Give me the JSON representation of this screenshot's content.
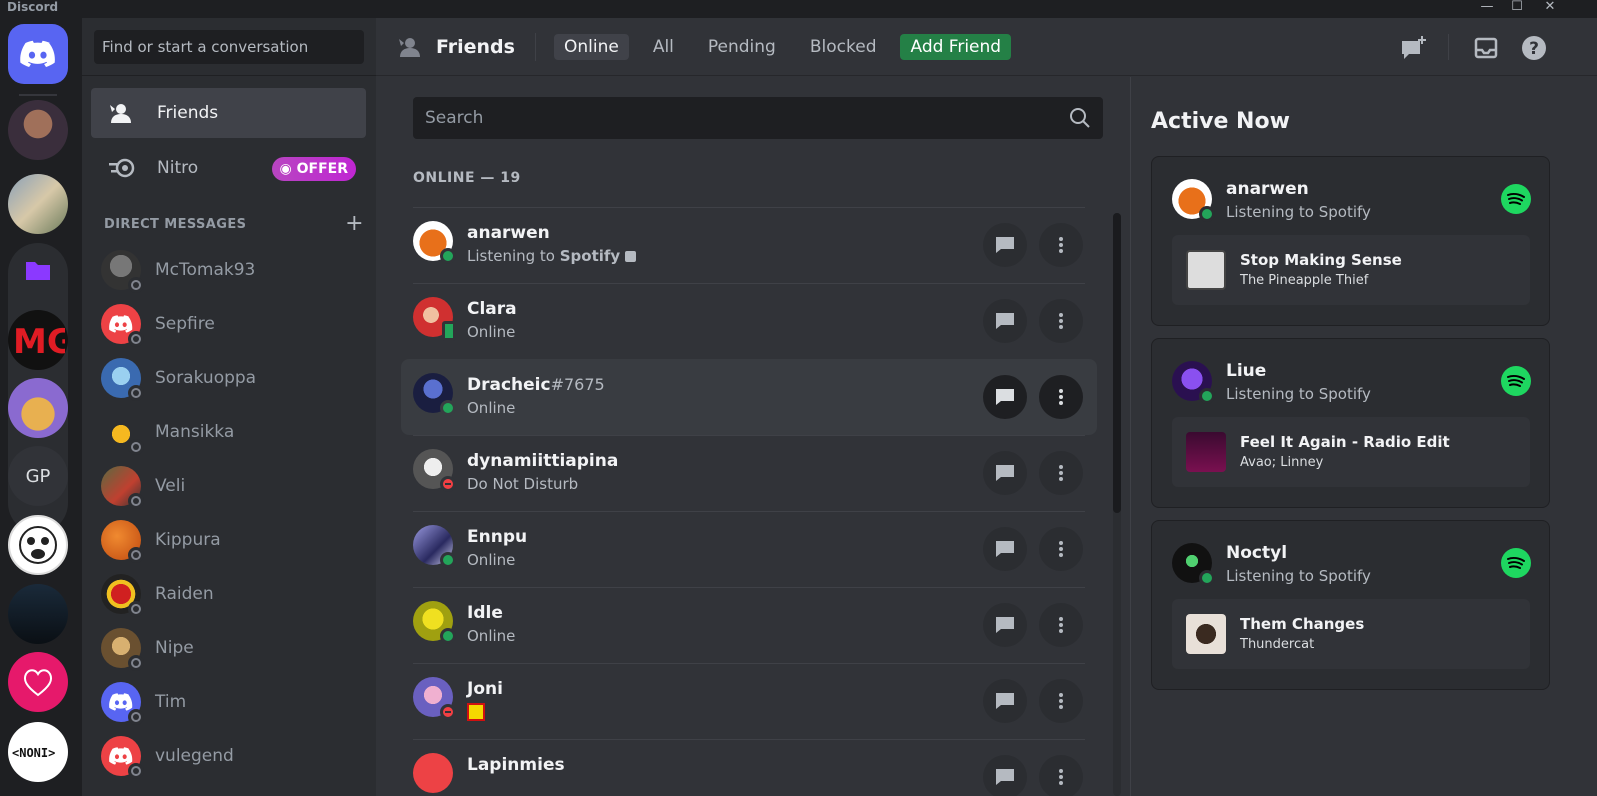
{
  "window": {
    "app_name": "Discord",
    "minimize": "—",
    "maximize": "☐",
    "close": "✕"
  },
  "servers": {
    "guild_initials": "GP"
  },
  "dm_sidebar": {
    "search_placeholder": "Find or start a conversation",
    "nav": {
      "friends": "Friends",
      "nitro": "Nitro",
      "offer": "OFFER"
    },
    "direct_messages_header": "DIRECT MESSAGES",
    "add_dm": "+",
    "dms": [
      "McTomak93",
      "Sepfire",
      "Sorakuoppa",
      "Mansikka",
      "Veli",
      "Kippura",
      "Raiden",
      "Nipe",
      "Tim",
      "vulegend"
    ]
  },
  "header": {
    "title": "Friends",
    "tabs": {
      "online": "Online",
      "all": "All",
      "pending": "Pending",
      "blocked": "Blocked",
      "add_friend": "Add Friend"
    }
  },
  "friends": {
    "search_placeholder": "Search",
    "online_header": "ONLINE — 19",
    "rows": [
      {
        "name": "anarwen",
        "tag": "",
        "status_prefix": "Listening to ",
        "status_bold": "Spotify",
        "status": ""
      },
      {
        "name": "Clara",
        "tag": "",
        "status_prefix": "",
        "status_bold": "",
        "status": "Online"
      },
      {
        "name": "Dracheic",
        "tag": "#7675",
        "status_prefix": "",
        "status_bold": "",
        "status": "Online"
      },
      {
        "name": "dynamiittiapina",
        "tag": "",
        "status_prefix": "",
        "status_bold": "",
        "status": "Do Not Disturb"
      },
      {
        "name": "Ennpu",
        "tag": "",
        "status_prefix": "",
        "status_bold": "",
        "status": "Online"
      },
      {
        "name": "Idle",
        "tag": "",
        "status_prefix": "",
        "status_bold": "",
        "status": "Online"
      },
      {
        "name": "Joni",
        "tag": "",
        "status_prefix": "",
        "status_bold": "",
        "status": ""
      },
      {
        "name": "Lapinmies",
        "tag": "",
        "status_prefix": "",
        "status_bold": "",
        "status": ""
      }
    ]
  },
  "active_now": {
    "title": "Active Now",
    "cards": [
      {
        "name": "anarwen",
        "activity": "Listening to Spotify",
        "track": "Stop Making Sense",
        "artist": "The Pineapple Thief"
      },
      {
        "name": "Liue",
        "activity": "Listening to Spotify",
        "track": "Feel It Again - Radio Edit",
        "artist": "Avao; Linney"
      },
      {
        "name": "Noctyl",
        "activity": "Listening to Spotify",
        "track": "Them Changes",
        "artist": "Thundercat"
      }
    ]
  },
  "colors": {
    "blurple": "#5865f2",
    "green": "#23a55a",
    "dnd": "#f23f43",
    "spotify": "#1ed760",
    "add_friend": "#248046"
  }
}
